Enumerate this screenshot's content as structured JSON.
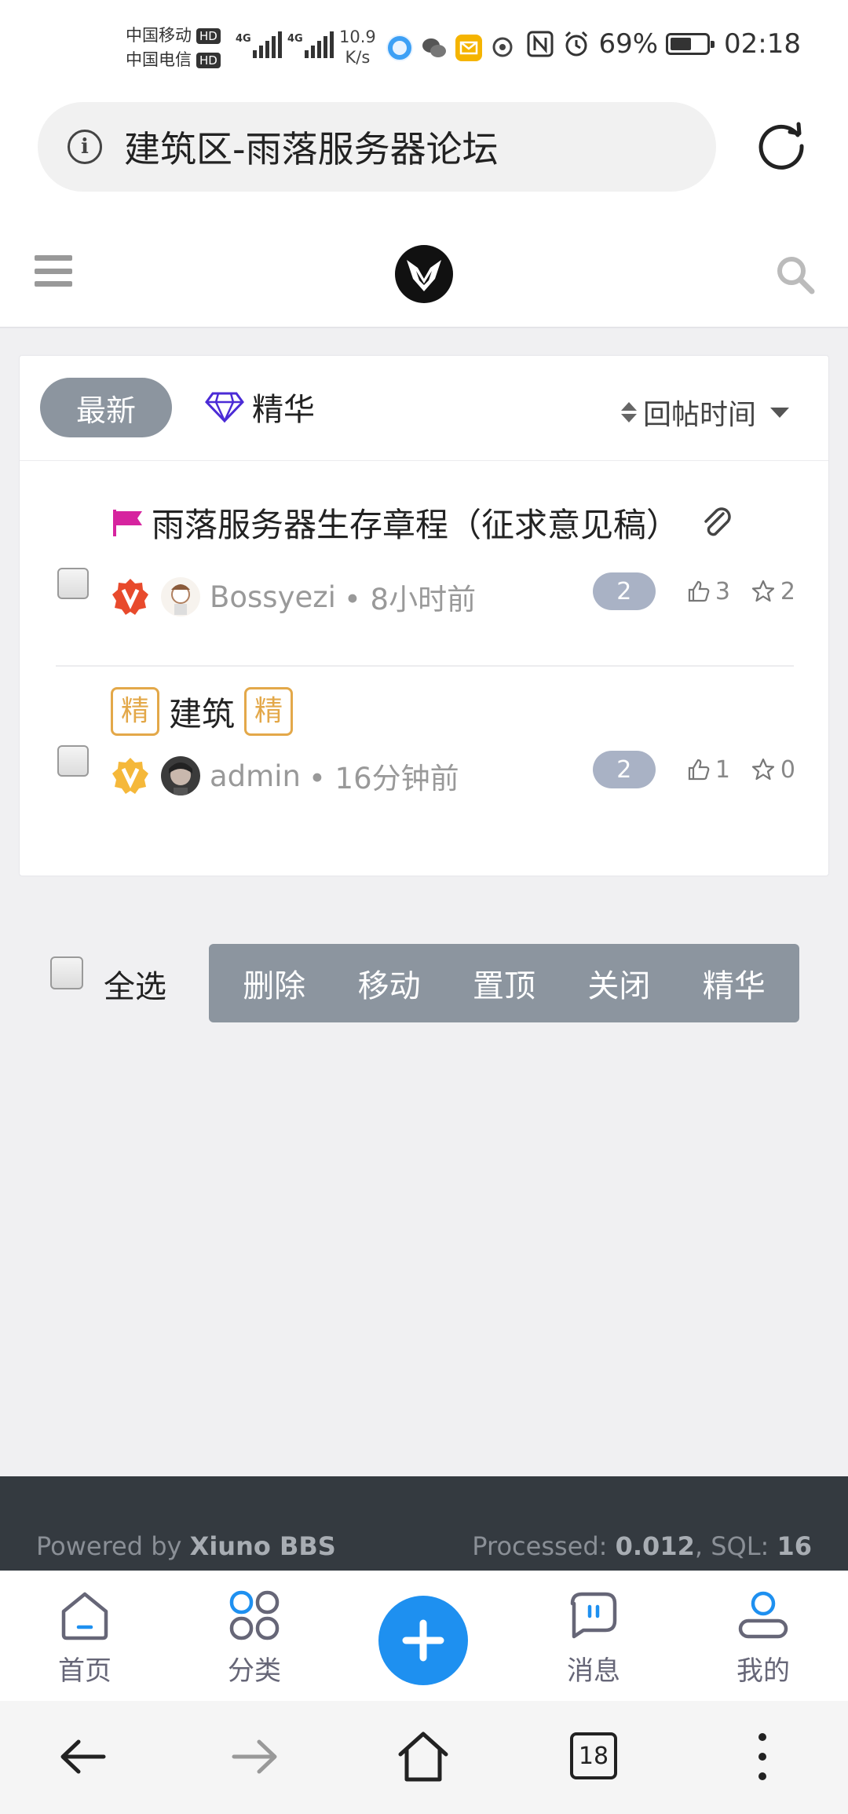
{
  "status_bar": {
    "carrier1": "中国移动",
    "carrier2": "中国电信",
    "hd": "HD",
    "net1": "4G",
    "net2": "4G",
    "speed_value": "10.9",
    "speed_unit": "K/s",
    "battery": "69%",
    "time": "02:18"
  },
  "address_bar": {
    "title": "建筑区-雨落服务器论坛",
    "info_glyph": "i"
  },
  "tabs": {
    "latest": "最新",
    "digest": "精华",
    "sort": "回帖时间"
  },
  "threads": [
    {
      "title": "雨落服务器生存章程（征求意见稿）",
      "author": "Bossyezi",
      "time": "• 8小时前",
      "replies": "2",
      "likes": "3",
      "favorites": "2"
    },
    {
      "tag_left": "精",
      "title": "建筑",
      "tag_right": "精",
      "author": "admin",
      "time": "• 16分钟前",
      "replies": "2",
      "likes": "1",
      "favorites": "0"
    }
  ],
  "moderation": {
    "select_all": "全选",
    "buttons": [
      "删除",
      "移动",
      "置顶",
      "关闭",
      "精华"
    ]
  },
  "footer": {
    "powered_prefix": "Powered by ",
    "powered_brand": "Xiuno BBS",
    "processed_label": "Processed: ",
    "processed_value": "0.012",
    "sql_label": ", SQL: ",
    "sql_value": "16"
  },
  "bottom_nav": {
    "home": "首页",
    "category": "分类",
    "messages": "消息",
    "mine": "我的"
  },
  "browser_nav": {
    "tab_count": "18"
  },
  "colors": {
    "accent_blue": "#1e90f0",
    "tab_gray": "#8c959f",
    "digest_gold": "#e3a849",
    "verified_red": "#e84a2c",
    "verified_gold": "#f5b83a",
    "footer_bg": "#343a40"
  }
}
